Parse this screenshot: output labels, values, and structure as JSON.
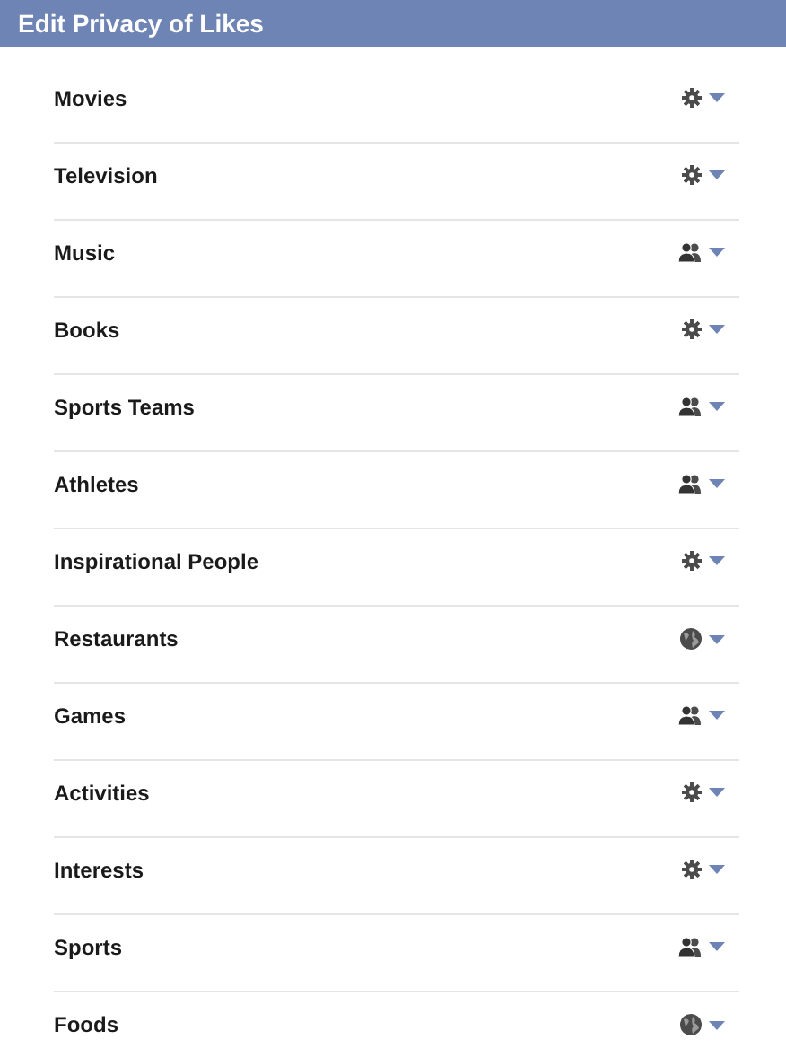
{
  "header": {
    "title": "Edit Privacy of Likes"
  },
  "categories": [
    {
      "label": "Movies",
      "kind": "custom"
    },
    {
      "label": "Television",
      "kind": "custom"
    },
    {
      "label": "Music",
      "kind": "friends"
    },
    {
      "label": "Books",
      "kind": "custom"
    },
    {
      "label": "Sports Teams",
      "kind": "friends"
    },
    {
      "label": "Athletes",
      "kind": "friends"
    },
    {
      "label": "Inspirational People",
      "kind": "custom"
    },
    {
      "label": "Restaurants",
      "kind": "public"
    },
    {
      "label": "Games",
      "kind": "friends"
    },
    {
      "label": "Activities",
      "kind": "custom"
    },
    {
      "label": "Interests",
      "kind": "custom"
    },
    {
      "label": "Sports",
      "kind": "friends"
    },
    {
      "label": "Foods",
      "kind": "public"
    }
  ]
}
